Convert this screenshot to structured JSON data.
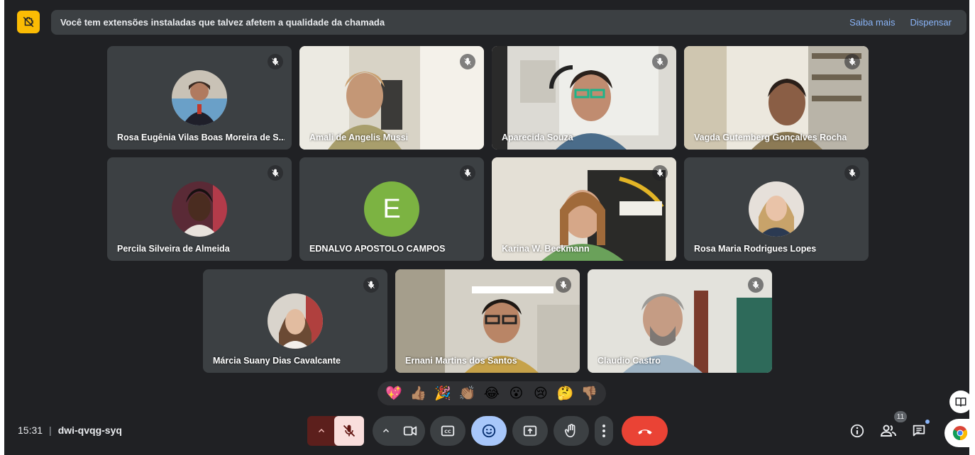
{
  "banner": {
    "message": "Você tem extensões instaladas que talvez afetem a qualidade da chamada",
    "learn_more": "Saiba mais",
    "dismiss": "Dispensar",
    "icon": "extension-warning-icon"
  },
  "participants": [
    {
      "name": "Rosa Eugênia Vilas Boas Moreira de S...",
      "muted": true,
      "display": "avatar"
    },
    {
      "name": "Amali de Angelis Mussi",
      "muted": true,
      "display": "video"
    },
    {
      "name": "Aparecida Souza",
      "muted": true,
      "display": "video"
    },
    {
      "name": "Vagda Gutemberg Gonçalves Rocha",
      "muted": true,
      "display": "video"
    },
    {
      "name": "Percila Silveira de Almeida",
      "muted": true,
      "display": "avatar"
    },
    {
      "name": "EDNALVO APOSTOLO CAMPOS",
      "muted": true,
      "display": "initial",
      "initial": "E"
    },
    {
      "name": "Karina W. Beckmann",
      "muted": true,
      "display": "video"
    },
    {
      "name": "Rosa Maria Rodrigues Lopes",
      "muted": true,
      "display": "avatar"
    },
    {
      "name": "Márcia Suany Dias Cavalcante",
      "muted": true,
      "display": "avatar"
    },
    {
      "name": "Ernani Martins dos Santos",
      "muted": true,
      "display": "video"
    },
    {
      "name": "Claudio Castro",
      "muted": true,
      "display": "video"
    }
  ],
  "reactions": [
    "💖",
    "👍🏽",
    "🎉",
    "👏🏽",
    "😂",
    "😮",
    "😢",
    "🤔",
    "👎🏽"
  ],
  "meeting": {
    "time": "15:31",
    "code": "dwi-qvqg-syq"
  },
  "participant_count": "11",
  "colors": {
    "background": "#202124",
    "tile": "#3c4043",
    "accent": "#8ab4f8",
    "end_call": "#ea4335",
    "warning": "#fbbc04",
    "mic_off": "#f9dedc"
  }
}
